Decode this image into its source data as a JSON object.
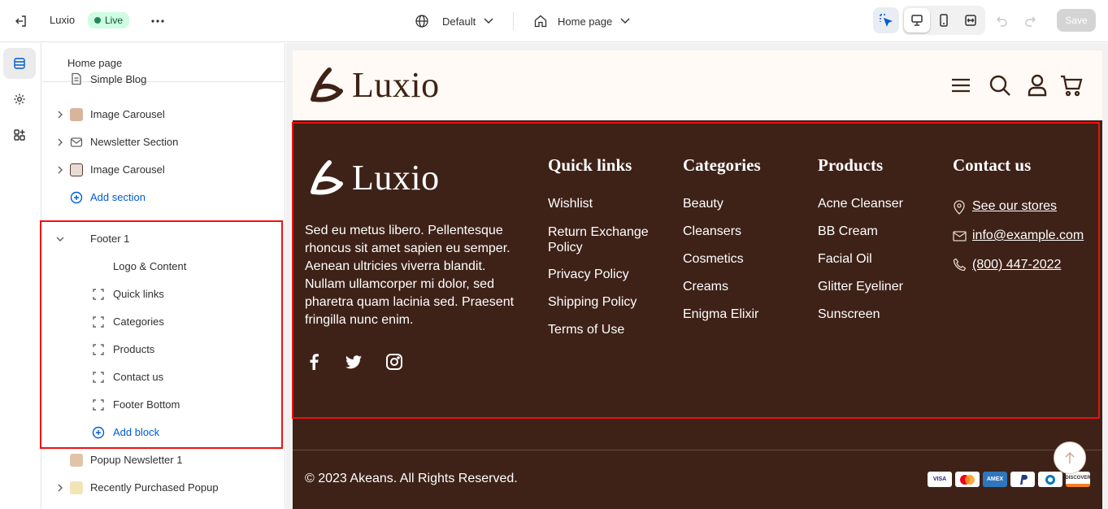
{
  "topbar": {
    "app_name": "Luxio",
    "status_badge": "Live",
    "theme_select": "Default",
    "page_select": "Home page",
    "save_label": "Save"
  },
  "sidebar": {
    "title": "Home page",
    "items": [
      {
        "label": "Simple Blog",
        "icon": "blog-icon"
      },
      {
        "label": "Image Carousel",
        "icon": "image-thumbnail-icon"
      },
      {
        "label": "Newsletter Section",
        "icon": "envelope-icon"
      },
      {
        "label": "Image Carousel",
        "icon": "image-thumbnail-icon"
      },
      {
        "label": "Add section",
        "icon": "plus-circle-icon"
      },
      {
        "label": "Footer 1",
        "icon": "chevron-down-icon"
      },
      {
        "label": "Logo & Content"
      },
      {
        "label": "Quick links",
        "icon": "block-dashed-icon"
      },
      {
        "label": "Categories",
        "icon": "block-dashed-icon"
      },
      {
        "label": "Products",
        "icon": "block-dashed-icon"
      },
      {
        "label": "Contact us",
        "icon": "block-dashed-icon"
      },
      {
        "label": "Footer Bottom",
        "icon": "block-dashed-icon"
      },
      {
        "label": "Add block",
        "icon": "plus-circle-icon"
      },
      {
        "label": "Popup Newsletter 1",
        "icon": "image-thumbnail-icon"
      },
      {
        "label": "Recently Purchased Popup",
        "icon": "image-thumbnail-icon"
      }
    ]
  },
  "store": {
    "logo_text": "Luxio",
    "footer": {
      "logo_text": "Luxio",
      "description": "Sed eu metus libero. Pellentesque rhoncus sit amet sapien eu semper. Aenean ultricies viverra blandit. Nullam ullamcorper mi dolor, sed pharetra quam lacinia sed. Praesent fringilla nunc enim.",
      "columns": [
        {
          "heading": "Quick links",
          "links": [
            "Wishlist",
            "Return Exchange Policy",
            "Privacy Policy",
            "Shipping Policy",
            "Terms of Use"
          ]
        },
        {
          "heading": "Categories",
          "links": [
            "Beauty",
            "Cleansers",
            "Cosmetics",
            "Creams",
            "Enigma Elixir"
          ]
        },
        {
          "heading": "Products",
          "links": [
            "Acne Cleanser",
            "BB Cream",
            "Facial Oil",
            "Glitter Eyeliner",
            "Sunscreen"
          ]
        }
      ],
      "contact": {
        "heading": "Contact us",
        "stores": "See our stores",
        "email": "info@example.com",
        "phone": "(800) 447-2022"
      },
      "copyright": "© 2023 Akeans. All Rights Reserved.",
      "payments": [
        "VISA",
        "mastercard",
        "AMEX",
        "PayPal",
        "Diners",
        "DISCOVER"
      ]
    }
  },
  "colors": {
    "footer_bg": "#3e2218",
    "header_bg": "#fffaf5",
    "highlight": "#e11111",
    "accent": "#005bd3",
    "live_badge": "#cdfee1"
  }
}
